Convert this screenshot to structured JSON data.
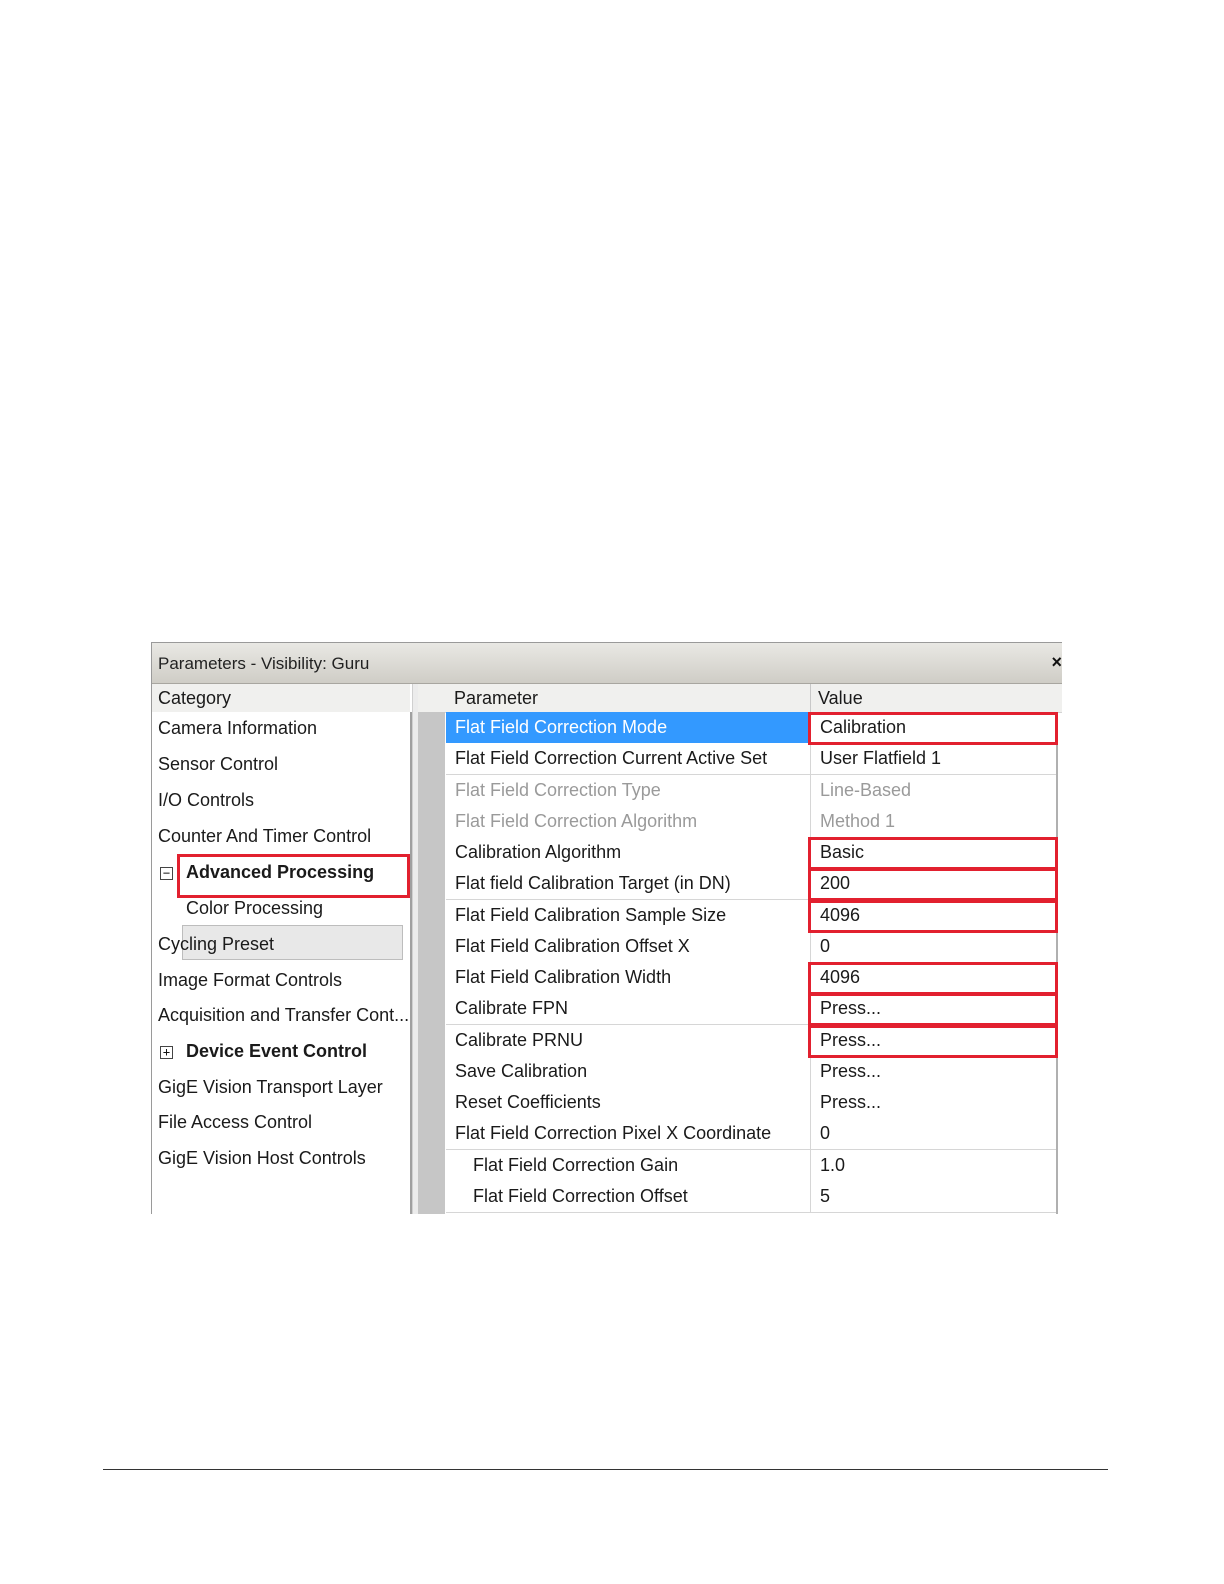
{
  "window": {
    "title": "Parameters - Visibility: Guru",
    "close_glyph": "×"
  },
  "categories": {
    "header": "Category",
    "items": [
      {
        "label": "Camera Information"
      },
      {
        "label": "Sensor Control"
      },
      {
        "label": "I/O Controls"
      },
      {
        "label": "Counter And Timer Control"
      },
      {
        "label": "Advanced Processing",
        "expander": "⊟",
        "selected": true
      },
      {
        "label": "Color Processing"
      },
      {
        "label": "Cycling Preset"
      },
      {
        "label": "Image Format Controls"
      },
      {
        "label": "Acquisition and Transfer Cont..."
      },
      {
        "label": "Device Event Control",
        "expander": "⊞"
      },
      {
        "label": "GigE Vision Transport Layer"
      },
      {
        "label": "File Access Control"
      },
      {
        "label": "GigE Vision Host Controls"
      }
    ]
  },
  "grid": {
    "col_parameter": "Parameter",
    "col_value": "Value",
    "rows": [
      {
        "parameter": "Flat Field Correction Mode",
        "value": "Calibration",
        "selected": true,
        "highlighted": true
      },
      {
        "parameter": "Flat Field Correction Current Active Set",
        "value": "User Flatfield 1"
      },
      {
        "parameter": "Flat Field Correction Type",
        "value": "Line-Based",
        "disabled": true
      },
      {
        "parameter": "Flat Field Correction Algorithm",
        "value": "Method 1",
        "disabled": true
      },
      {
        "parameter": "Calibration Algorithm",
        "value": "Basic",
        "highlighted": true
      },
      {
        "parameter": "Flat field Calibration Target (in DN)",
        "value": "200",
        "highlighted": true
      },
      {
        "parameter": "Flat Field Calibration Sample Size",
        "value": "4096",
        "highlighted": true
      },
      {
        "parameter": "Flat Field Calibration Offset X",
        "value": "0"
      },
      {
        "parameter": "Flat Field Calibration Width",
        "value": "4096",
        "highlighted": true
      },
      {
        "parameter": "Calibrate FPN",
        "value": "Press...",
        "highlighted": true
      },
      {
        "parameter": "Calibrate PRNU",
        "value": "Press...",
        "highlighted": true
      },
      {
        "parameter": "Save Calibration",
        "value": "Press..."
      },
      {
        "parameter": "Reset Coefficients",
        "value": "Press..."
      },
      {
        "parameter": "Flat Field Correction Pixel X Coordinate",
        "value": "0"
      },
      {
        "parameter": "Flat Field Correction Gain",
        "value": "1.0",
        "indented": true
      },
      {
        "parameter": "Flat Field Correction Offset",
        "value": "5",
        "indented": true
      }
    ]
  },
  "colors": {
    "selection": "#3399ff",
    "highlight_box": "#e2202f",
    "disabled_text": "#9a9a9a"
  }
}
